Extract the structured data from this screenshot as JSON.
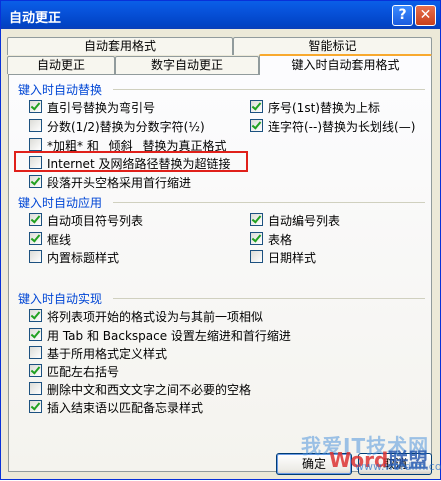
{
  "window": {
    "title": "自动更正",
    "help_glyph": "?",
    "close_glyph": "✕"
  },
  "tabs_back": [
    "自动套用格式",
    "智能标记"
  ],
  "tabs_front": [
    "自动更正",
    "数字自动更正",
    "键入时自动套用格式"
  ],
  "groups": [
    {
      "title": "键入时自动替换",
      "options": [
        {
          "label": "直引号替换为弯引号",
          "checked": true
        },
        {
          "label": "序号(1st)替换为上标",
          "checked": true
        },
        {
          "label": "分数(1/2)替换为分数字符(½)",
          "checked": false
        },
        {
          "label": "连字符(--)替换为长划线(—)",
          "checked": true
        },
        {
          "label": "*加粗* 和 _倾斜_ 替换为真正格式",
          "checked": false
        },
        {
          "label": "Internet 及网络路径替换为超链接",
          "checked": false
        },
        {
          "label": "段落开头空格采用首行缩进",
          "checked": true
        }
      ]
    },
    {
      "title": "键入时自动应用",
      "options": [
        {
          "label": "自动项目符号列表",
          "checked": true
        },
        {
          "label": "自动编号列表",
          "checked": true
        },
        {
          "label": "框线",
          "checked": true
        },
        {
          "label": "表格",
          "checked": true
        },
        {
          "label": "内置标题样式",
          "checked": false
        },
        {
          "label": "日期样式",
          "checked": false
        }
      ]
    },
    {
      "title": "键入时自动实现",
      "options": [
        {
          "label": "将列表项开始的格式设为与其前一项相似",
          "checked": true
        },
        {
          "label": "用 Tab 和 Backspace 设置左缩进和首行缩进",
          "checked": true
        },
        {
          "label": "基于所用格式定义样式",
          "checked": false
        },
        {
          "label": "匹配左右括号",
          "checked": true
        },
        {
          "label": "删除中文和西文文字之间不必要的空格",
          "checked": false
        },
        {
          "label": "插入结束语以匹配备忘录样式",
          "checked": true
        }
      ]
    }
  ],
  "buttons": {
    "ok": "确定",
    "cancel": "取消"
  },
  "watermark": {
    "line1": "我爱IT技术网",
    "logo_word": "Word",
    "logo_suffix": "联盟",
    "url": "www.wordlm.com"
  },
  "colors": {
    "title_bar": "#0751d9",
    "group_title": "#0046d5",
    "highlight": "#e0201a"
  }
}
